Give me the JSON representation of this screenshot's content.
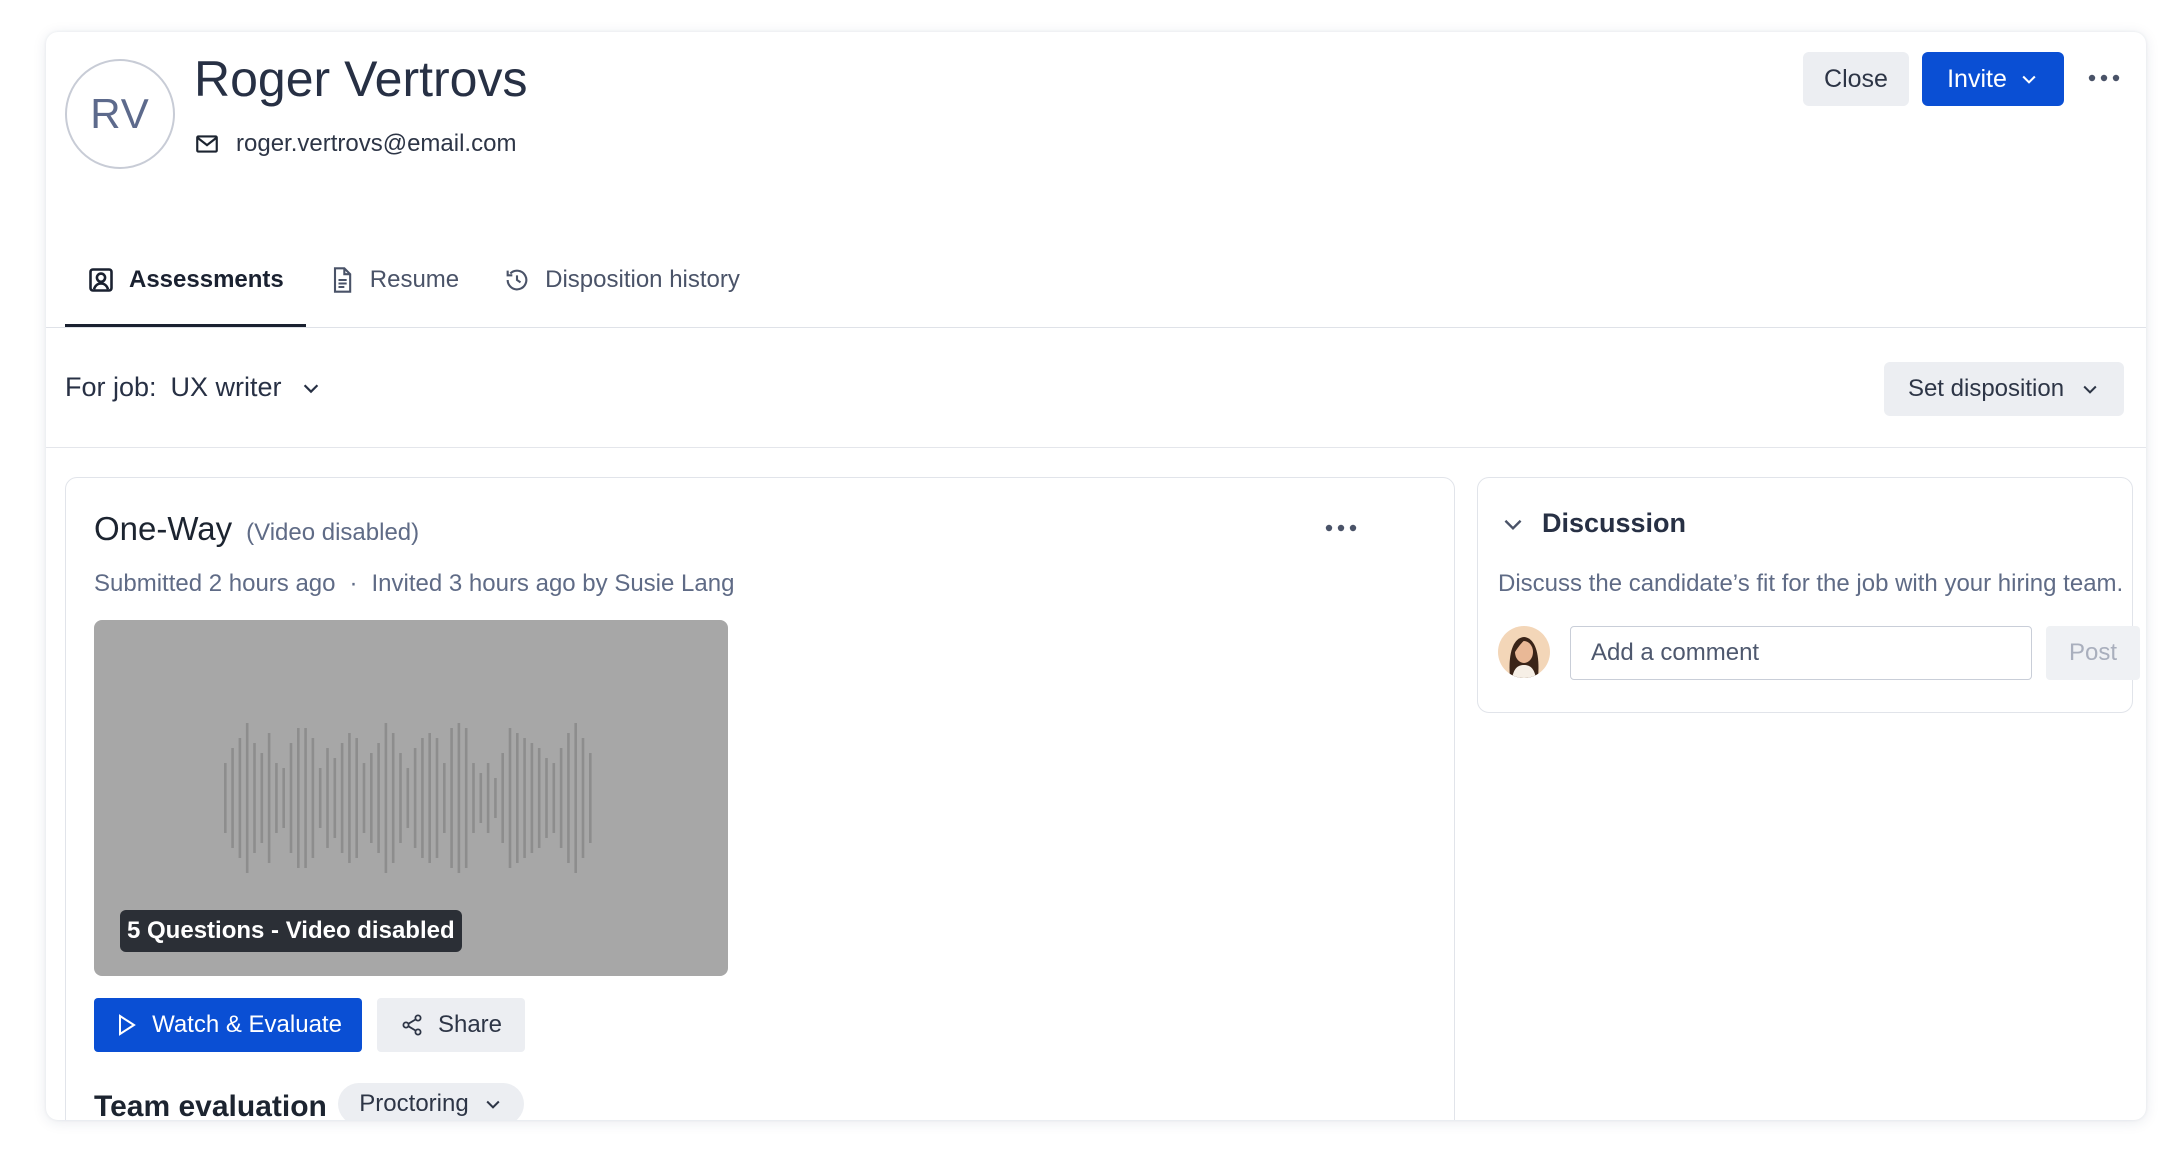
{
  "candidate": {
    "initials": "RV",
    "name": "Roger Vertrovs",
    "email": "roger.vertrovs@email.com"
  },
  "header": {
    "close_label": "Close",
    "invite_label": "Invite"
  },
  "tabs": [
    {
      "label": "Assessments",
      "icon": "user-square-icon",
      "active": true
    },
    {
      "label": "Resume",
      "icon": "document-icon",
      "active": false
    },
    {
      "label": "Disposition history",
      "icon": "history-icon",
      "active": false
    }
  ],
  "job": {
    "label": "For job:",
    "value": "UX writer",
    "disposition_label": "Set disposition"
  },
  "assessment": {
    "title": "One-Way",
    "subtitle": "(Video disabled)",
    "submitted": "Submitted 2 hours ago",
    "separator": "·",
    "invited": "Invited 3 hours ago by Susie Lang",
    "thumbnail_badge": "5 Questions - Video disabled",
    "watch_label": "Watch & Evaluate",
    "share_label": "Share",
    "team_eval_label": "Team evaluation",
    "proctoring_label": "Proctoring"
  },
  "discussion": {
    "title": "Discussion",
    "description": "Discuss the candidate’s fit for the job with your hiring team.",
    "comment_placeholder": "Add a comment",
    "post_label": "Post"
  },
  "colors": {
    "primary": "#0a4fd4",
    "secondary_button": "#eceef2",
    "thumbnail_bg": "#a7a7a7",
    "muted_text": "#5f6b86"
  }
}
